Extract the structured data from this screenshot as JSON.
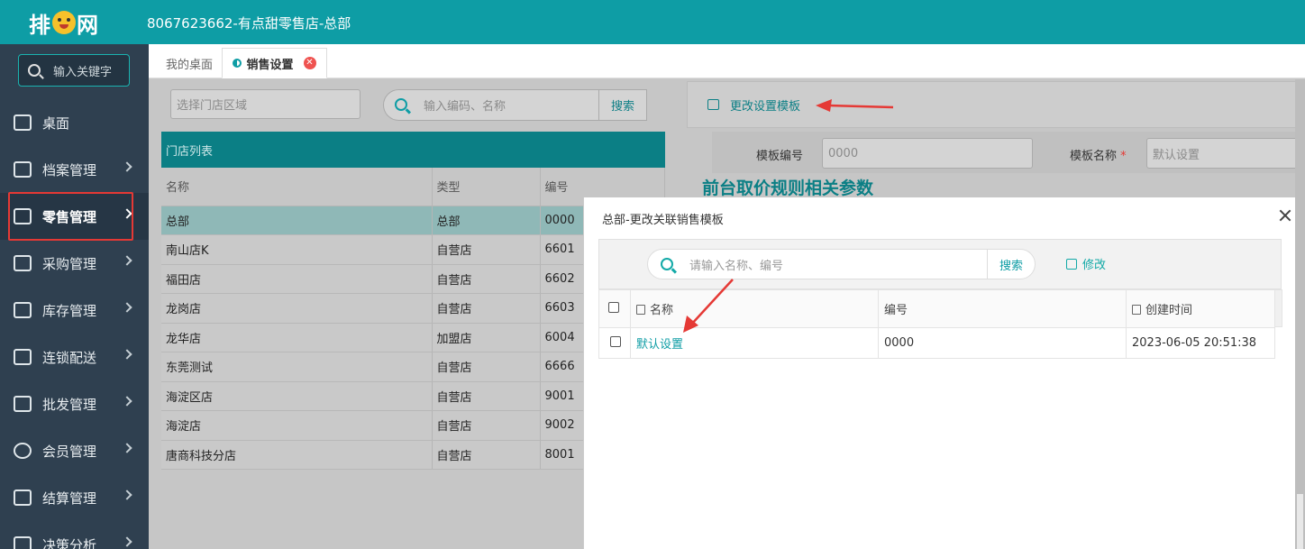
{
  "app": {
    "logo_text_a": "排",
    "logo_text_b": "网",
    "title": "8067623662-有点甜零售店-总部"
  },
  "sidebar": {
    "search_placeholder": "输入关键字",
    "items": [
      {
        "label": "桌面",
        "icon": "desktop-icon"
      },
      {
        "label": "档案管理",
        "icon": "archive-icon"
      },
      {
        "label": "零售管理",
        "icon": "store-icon",
        "active": true
      },
      {
        "label": "采购管理",
        "icon": "purchase-icon"
      },
      {
        "label": "库存管理",
        "icon": "inventory-icon"
      },
      {
        "label": "连锁配送",
        "icon": "truck-icon"
      },
      {
        "label": "批发管理",
        "icon": "wholesale-icon"
      },
      {
        "label": "会员管理",
        "icon": "member-icon"
      },
      {
        "label": "结算管理",
        "icon": "wallet-icon"
      },
      {
        "label": "决策分析",
        "icon": "chart-icon"
      }
    ]
  },
  "tabs": {
    "desktop": "我的桌面",
    "sales_settings": "销售设置"
  },
  "left": {
    "store_area_placeholder": "选择门店区域",
    "search_placeholder": "输入编码、名称",
    "search_button": "搜索",
    "list_title": "门店列表",
    "columns": [
      "名称",
      "类型",
      "编号"
    ],
    "rows": [
      [
        "总部",
        "总部",
        "0000"
      ],
      [
        "南山店K",
        "自营店",
        "6601"
      ],
      [
        "福田店",
        "自营店",
        "6602"
      ],
      [
        "龙岗店",
        "自营店",
        "6603"
      ],
      [
        "龙华店",
        "加盟店",
        "6004"
      ],
      [
        "东莞测试",
        "自营店",
        "6666"
      ],
      [
        "海淀区店",
        "自营店",
        "9001"
      ],
      [
        "海淀店",
        "自营店",
        "9002"
      ],
      [
        "唐商科技分店",
        "自营店",
        "8001"
      ]
    ]
  },
  "right": {
    "change_template_link": "更改设置模板",
    "template_no_label": "模板编号",
    "template_no_value": "0000",
    "template_name_label": "模板名称",
    "template_name_required": "*",
    "template_name_value": "默认设置",
    "section_title": "前台取价规则相关参数"
  },
  "modal": {
    "title": "总部-更改关联销售模板",
    "search_placeholder": "请输入名称、编号",
    "search_button": "搜索",
    "edit_button": "修改",
    "columns": [
      "名称",
      "编号",
      "创建时间"
    ],
    "rows": [
      {
        "name": "默认设置",
        "code": "0000",
        "created": "2023-06-05 20:51:38"
      }
    ]
  },
  "colors": {
    "brand": "#0e9da5",
    "sidebar_bg": "#2f4050",
    "annotation_red": "#e53935"
  }
}
